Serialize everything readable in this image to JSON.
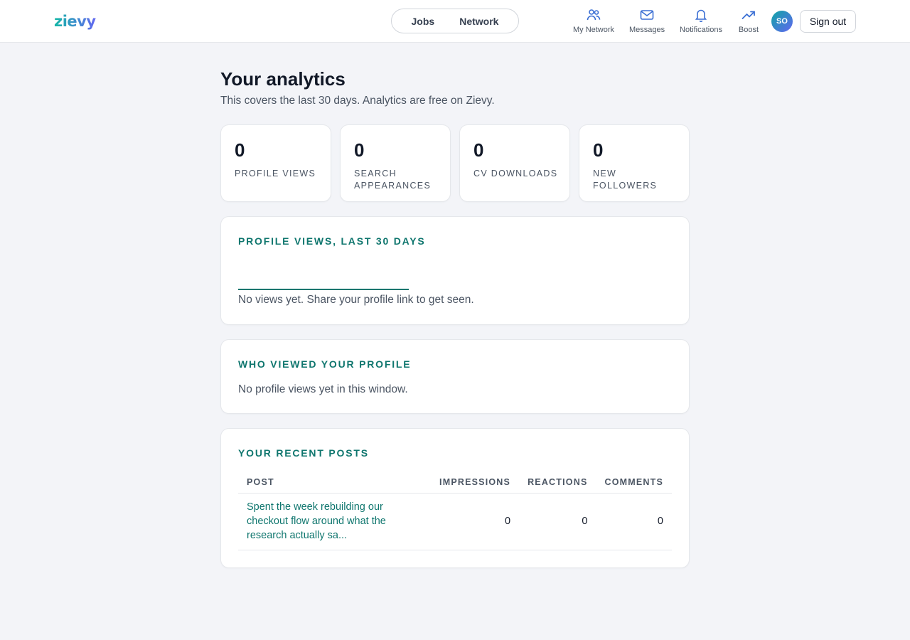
{
  "header": {
    "logo": "zievy",
    "switch": {
      "jobs": "Jobs",
      "network": "Network"
    },
    "nav": [
      {
        "label": "My Network",
        "icon": "people-icon"
      },
      {
        "label": "Messages",
        "icon": "envelope-icon"
      },
      {
        "label": "Notifications",
        "icon": "bell-icon"
      },
      {
        "label": "Boost",
        "icon": "trend-up-icon"
      }
    ],
    "avatar_initials": "SO",
    "signout_label": "Sign out"
  },
  "page": {
    "title": "Your analytics",
    "subtitle": "This covers the last 30 days. Analytics are free on Zievy."
  },
  "stats": [
    {
      "value": "0",
      "label": "Profile views"
    },
    {
      "value": "0",
      "label": "Search appearances"
    },
    {
      "value": "0",
      "label": "CV downloads"
    },
    {
      "value": "0",
      "label": "New followers"
    }
  ],
  "views_chart": {
    "title": "Profile views, last 30 days",
    "empty_text": "No views yet. Share your profile link to get seen."
  },
  "viewers": {
    "title": "Who viewed your profile",
    "empty_text": "No profile views yet in this window."
  },
  "recent_posts": {
    "title": "Your recent posts",
    "columns": [
      "Post",
      "Impressions",
      "Reactions",
      "Comments"
    ],
    "rows": [
      {
        "post": "Spent the week rebuilding our checkout flow around what the research actually sa...",
        "impressions": "0",
        "reactions": "0",
        "comments": "0"
      }
    ]
  },
  "colors": {
    "accent": "#0f766e",
    "background": "#f3f4f8",
    "nav_icon": "#3b6fd4"
  }
}
